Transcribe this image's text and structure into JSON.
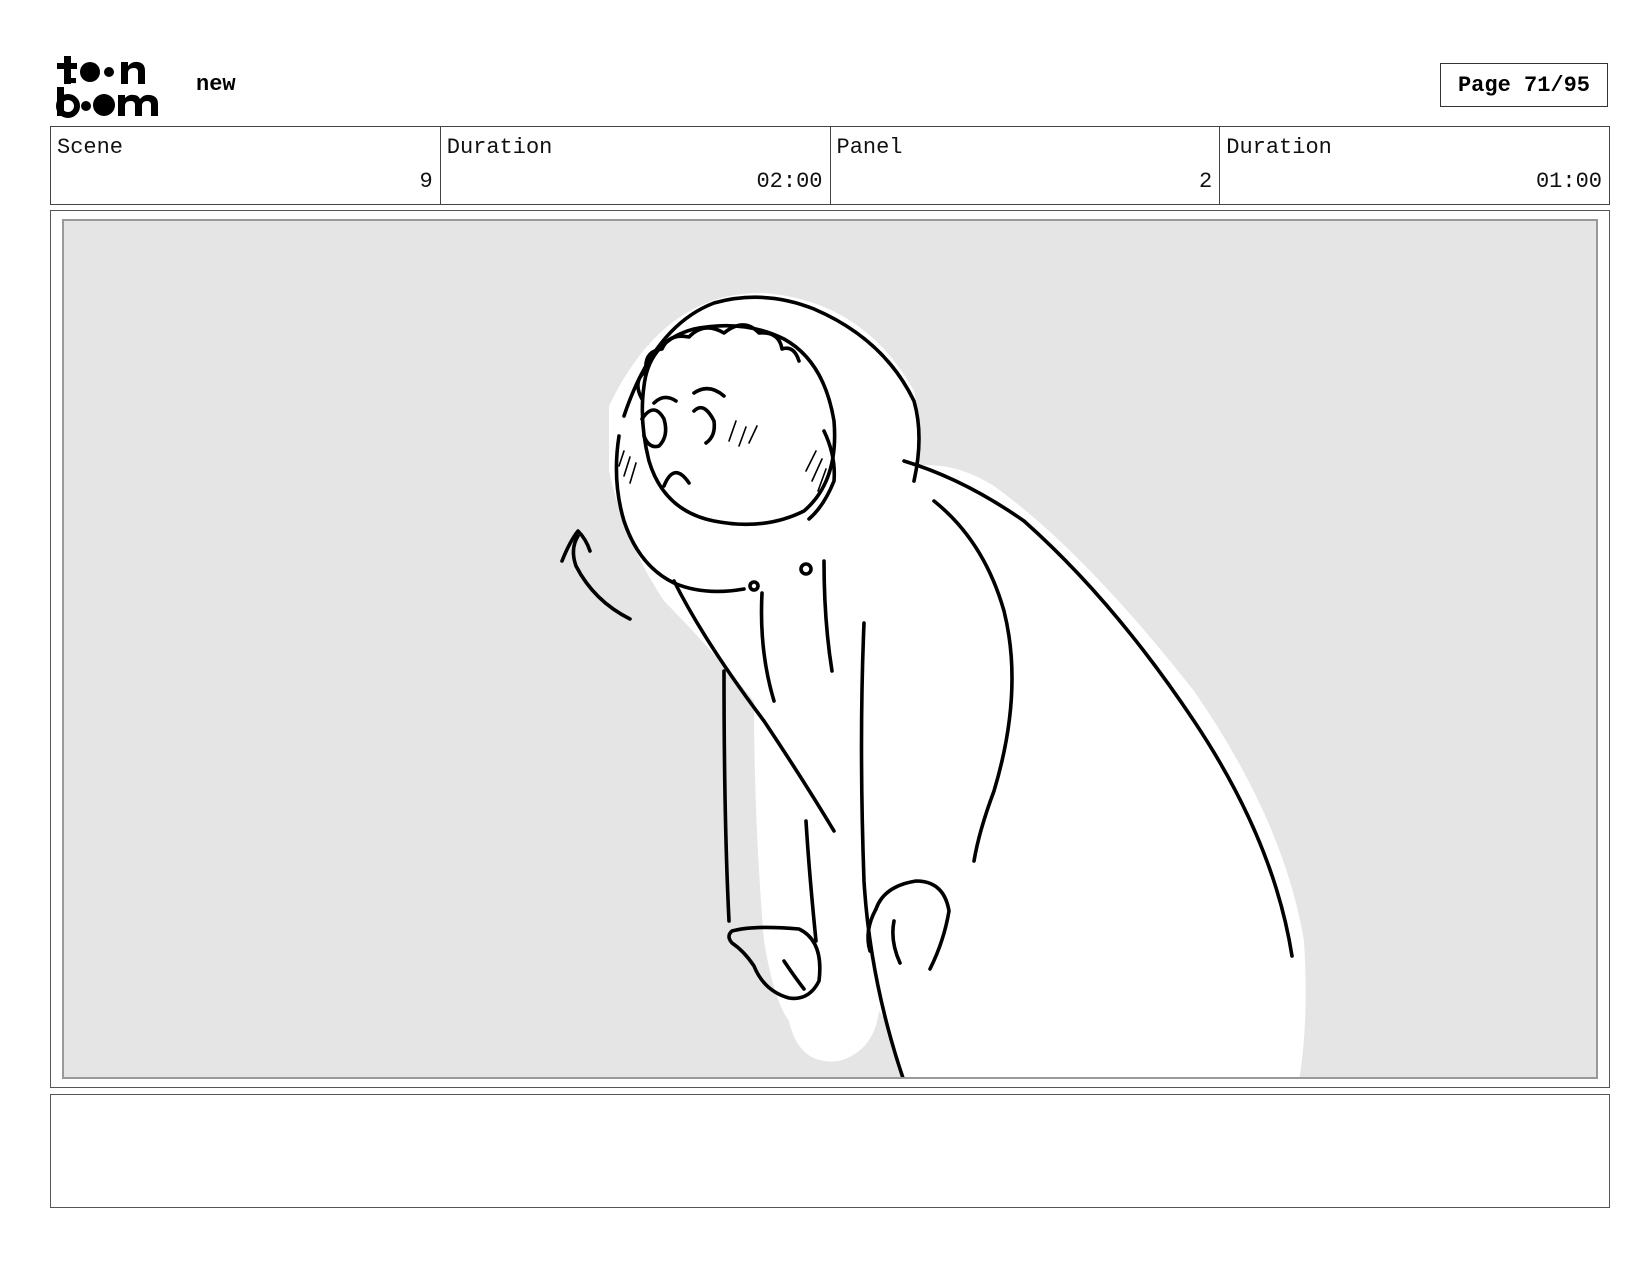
{
  "header": {
    "logo_line1": "toon",
    "logo_line2": "boom",
    "project_name": "new",
    "page_label": "Page 71/95"
  },
  "info": [
    {
      "label": "Scene",
      "value": "9"
    },
    {
      "label": "Duration",
      "value": "02:00"
    },
    {
      "label": "Panel",
      "value": "2"
    },
    {
      "label": "Duration",
      "value": "01:00"
    }
  ],
  "notes": {
    "text": ""
  }
}
